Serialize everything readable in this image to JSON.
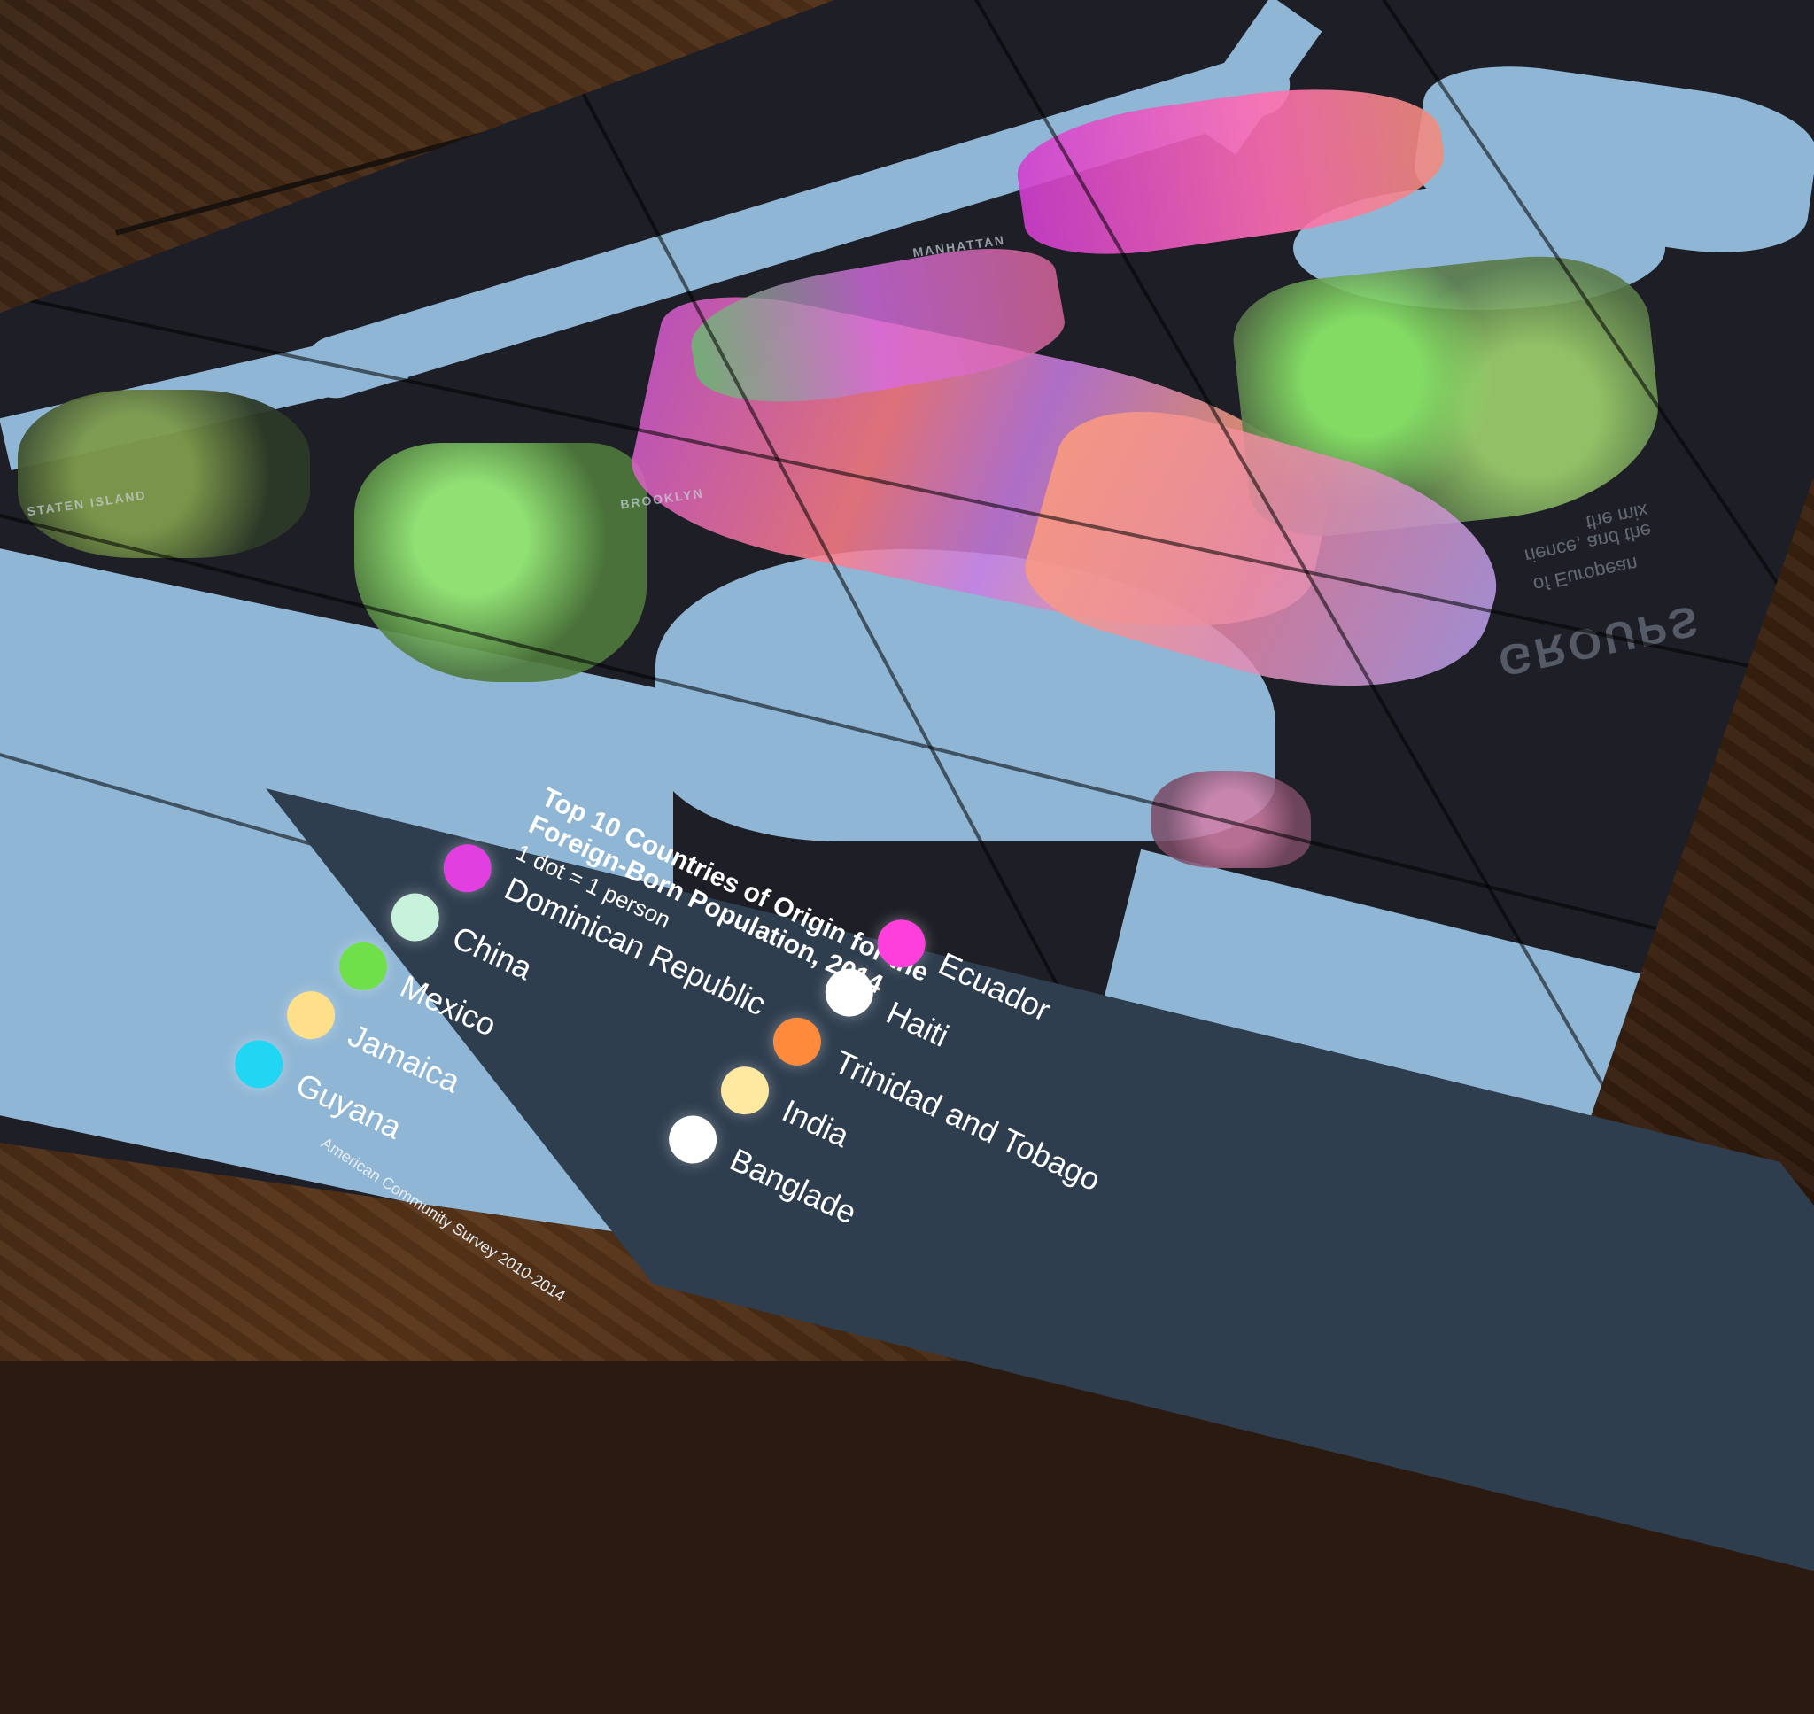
{
  "map": {
    "place_labels": [
      "STATEN ISLAND",
      "BROOKLYN",
      "MANHATTAN"
    ],
    "mirrored_text": {
      "lines": [
        "the mix",
        "rience, and the",
        "of European"
      ],
      "heading": "GROUPS"
    }
  },
  "legend": {
    "title": "Top 10 Countries of Origin for the Foreign-Born Population, 2014",
    "subtitle": "1 dot = 1 person",
    "items": [
      {
        "label": "Dominican Republic",
        "color": "#e23fe0"
      },
      {
        "label": "China",
        "color": "#c9f2dc"
      },
      {
        "label": "Mexico",
        "color": "#6fe04a"
      },
      {
        "label": "Jamaica",
        "color": "#ffe08a"
      },
      {
        "label": "Guyana",
        "color": "#20d6f2"
      },
      {
        "label": "Ecuador",
        "color": "#ff3fdc"
      },
      {
        "label": "Haiti",
        "color": "#ffffff"
      },
      {
        "label": "Trinidad and Tobago",
        "color": "#ff8a3c"
      },
      {
        "label": "India",
        "color": "#ffe8a0"
      },
      {
        "label": "Banglade",
        "color": "#ffffff"
      }
    ],
    "source": "American Community Survey 2010-2014"
  }
}
